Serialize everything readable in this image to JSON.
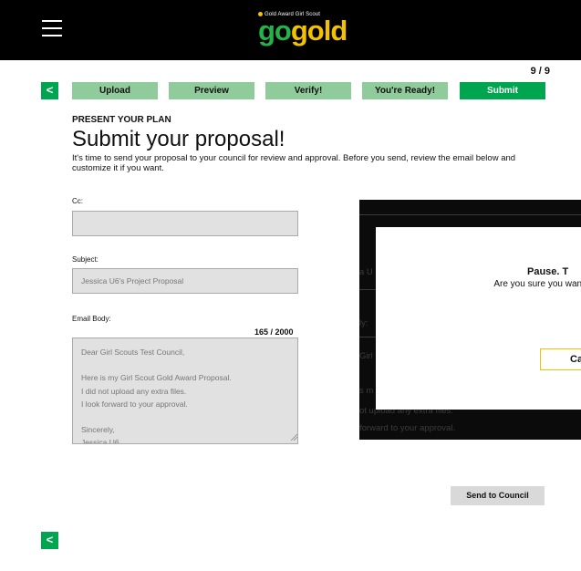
{
  "header": {
    "logo_tagline": "Gold Award Girl Scout",
    "logo_go": "go",
    "logo_gold": "gold",
    "menu_icon": "hamburger-menu-icon"
  },
  "progress": {
    "counter": "9 / 9",
    "back_label": "<",
    "steps": [
      {
        "label": "Upload"
      },
      {
        "label": "Preview"
      },
      {
        "label": "Verify!"
      },
      {
        "label": "You're Ready!"
      },
      {
        "label": "Submit"
      }
    ],
    "active_step": 4
  },
  "content": {
    "kicker": "PRESENT YOUR PLAN",
    "title": "Submit your proposal!",
    "intro": "It's time to send your proposal to your council for review and approval. Before you send, review the email below and customize it if you want."
  },
  "form": {
    "cc_label": "Cc:",
    "cc_value": "",
    "subject_label": "Subject:",
    "subject_value": "Jessica U6's Project Proposal",
    "body_label": "Email Body:",
    "body_counter": "165 / 2000",
    "body_value": "Dear Girl Scouts Test Council,\n\nHere is my Girl Scout Gold Award Proposal.\nI did not upload any extra files.\nI look forward to your approval.\n\nSincerely,\nJessica U6"
  },
  "overlay_background": {
    "frag_1": "a U",
    "frag_2": "ly:",
    "frag_3": "Girl",
    "frag_4": "s m",
    "frag_5": "ot upload any extra files.",
    "frag_6": "forward to your approval."
  },
  "dialog": {
    "title": "Pause. T",
    "message": "Are you sure you want send it\"",
    "cancel_label": "Cance"
  },
  "footer": {
    "send_label": "Send to Council",
    "back_label": "<"
  },
  "colors": {
    "brand_green": "#00a550",
    "step_inactive": "#8fcb9b",
    "gold": "#f2c200",
    "topbar": "#000000"
  }
}
